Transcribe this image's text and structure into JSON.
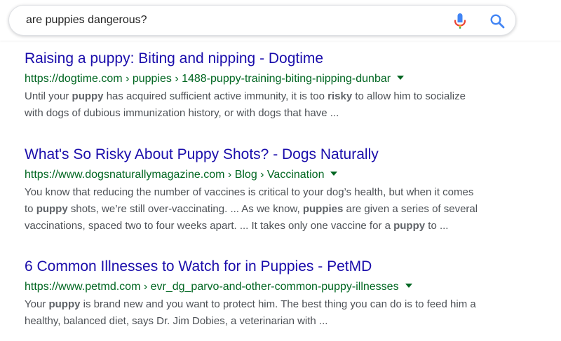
{
  "search": {
    "query": "are puppies dangerous?",
    "mic_icon": "microphone-icon",
    "search_icon": "magnifier-icon"
  },
  "colors": {
    "title_link": "#1a0dab",
    "url": "#006621",
    "snippet": "#4d5156",
    "mic_blue": "#4285f4",
    "mic_red": "#ea4335",
    "mic_yellow": "#fbbc05",
    "mic_green": "#34a853",
    "search_icon_blue": "#4285f4"
  },
  "results": [
    {
      "title": "Raising a puppy: Biting and nipping - Dogtime",
      "url": "https://dogtime.com › puppies › 1488-puppy-training-biting-nipping-dunbar",
      "snippet_lines": [
        [
          {
            "t": "Until your ",
            "b": false
          },
          {
            "t": "puppy",
            "b": true
          },
          {
            "t": " has acquired sufficient active immunity, it is too ",
            "b": false
          },
          {
            "t": "risky",
            "b": true
          },
          {
            "t": " to allow him to socialize",
            "b": false
          }
        ],
        [
          {
            "t": "with dogs of dubious immunization history, or with dogs that have ...",
            "b": false
          }
        ]
      ]
    },
    {
      "title": "What's So Risky About Puppy Shots? - Dogs Naturally",
      "url": "https://www.dogsnaturallymagazine.com › Blog › Vaccination",
      "snippet_lines": [
        [
          {
            "t": "You know that reducing the number of vaccines is critical to your dog’s health, but when it comes",
            "b": false
          }
        ],
        [
          {
            "t": "to ",
            "b": false
          },
          {
            "t": "puppy",
            "b": true
          },
          {
            "t": " shots, we’re still over-vaccinating. ... As we know, ",
            "b": false
          },
          {
            "t": "puppies",
            "b": true
          },
          {
            "t": " are given a series of several",
            "b": false
          }
        ],
        [
          {
            "t": "vaccinations, spaced two to four weeks apart. ... It takes only one vaccine for a ",
            "b": false
          },
          {
            "t": "puppy",
            "b": true
          },
          {
            "t": " to ...",
            "b": false
          }
        ]
      ]
    },
    {
      "title": "6 Common Illnesses to Watch for in Puppies - PetMD",
      "url": "https://www.petmd.com › evr_dg_parvo-and-other-common-puppy-illnesses",
      "snippet_lines": [
        [
          {
            "t": "Your ",
            "b": false
          },
          {
            "t": "puppy",
            "b": true
          },
          {
            "t": " is brand new and you want to protect him. The best thing you can do is to feed him a",
            "b": false
          }
        ],
        [
          {
            "t": "healthy, balanced diet, says Dr. Jim Dobies, a veterinarian with ...",
            "b": false
          }
        ]
      ]
    }
  ]
}
